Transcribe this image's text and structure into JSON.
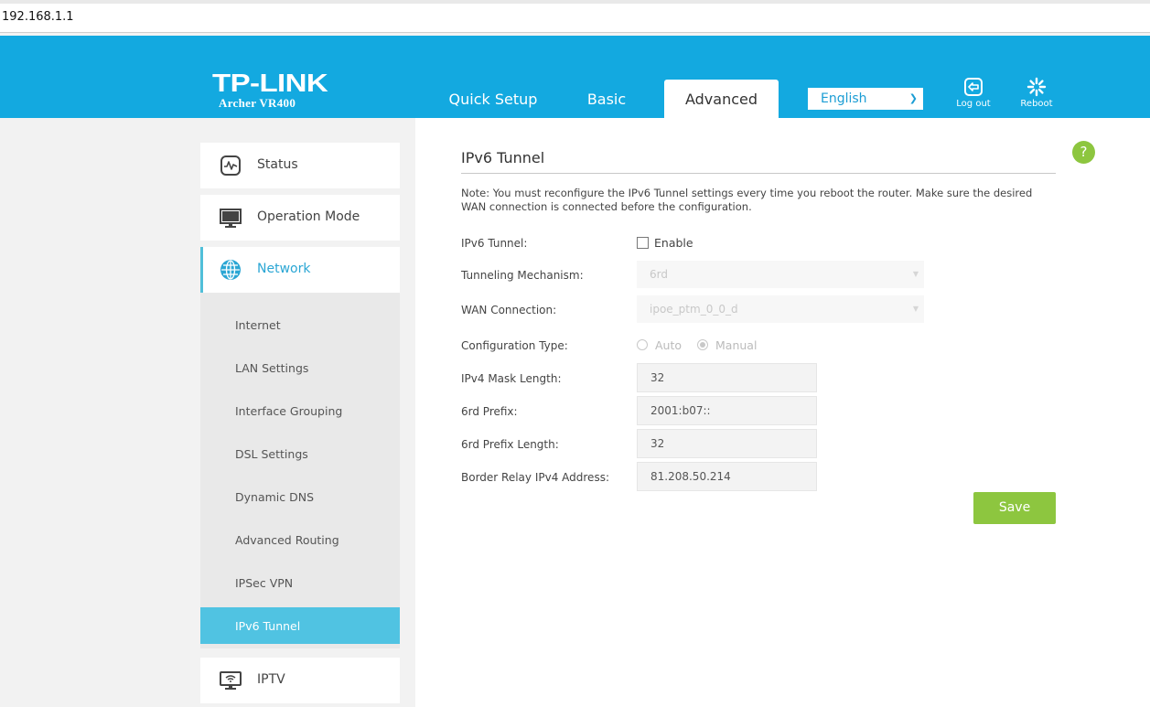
{
  "browser": {
    "url": "192.168.1.1"
  },
  "brand": {
    "logo": "TP-LINK",
    "model": "Archer VR400",
    "accent": "#13a9e0",
    "green": "#8dc63f"
  },
  "header": {
    "tabs": [
      {
        "label": "Quick Setup",
        "active": false
      },
      {
        "label": "Basic",
        "active": false
      },
      {
        "label": "Advanced",
        "active": true
      }
    ],
    "language": {
      "selected": "English"
    },
    "logout_label": "Log out",
    "reboot_label": "Reboot"
  },
  "sidebar": {
    "main_items": [
      {
        "label": "Status",
        "icon": "status-icon"
      },
      {
        "label": "Operation Mode",
        "icon": "monitor-icon"
      },
      {
        "label": "Network",
        "icon": "globe-icon",
        "active": true
      },
      {
        "label": "IPTV",
        "icon": "iptv-icon"
      }
    ],
    "network_sub_items": [
      {
        "label": "Internet"
      },
      {
        "label": "LAN Settings"
      },
      {
        "label": "Interface Grouping"
      },
      {
        "label": "DSL Settings"
      },
      {
        "label": "Dynamic DNS"
      },
      {
        "label": "Advanced Routing"
      },
      {
        "label": "IPSec VPN"
      },
      {
        "label": "IPv6 Tunnel",
        "active": true
      }
    ]
  },
  "main": {
    "title": "IPv6 Tunnel",
    "help_label": "?",
    "note": "Note: You must reconfigure the IPv6 Tunnel settings every time you reboot the router. Make sure the desired WAN connection is connected before the configuration.",
    "fields": {
      "ipv6_tunnel": {
        "label": "IPv6 Tunnel:",
        "checkbox_label": "Enable",
        "checked": false
      },
      "tunneling_mechanism": {
        "label": "Tunneling Mechanism:",
        "value": "6rd"
      },
      "wan_connection": {
        "label": "WAN Connection:",
        "value": "ipoe_ptm_0_0_d"
      },
      "configuration_type": {
        "label": "Configuration Type:",
        "options": [
          "Auto",
          "Manual"
        ],
        "selected": "Manual"
      },
      "ipv4_mask_length": {
        "label": "IPv4 Mask Length:",
        "value": "32"
      },
      "sixrd_prefix": {
        "label": "6rd Prefix:",
        "value": "2001:b07::"
      },
      "sixrd_prefix_length": {
        "label": "6rd Prefix Length:",
        "value": "32"
      },
      "border_relay": {
        "label": "Border Relay IPv4 Address:",
        "value": "81.208.50.214"
      }
    },
    "save_label": "Save"
  }
}
